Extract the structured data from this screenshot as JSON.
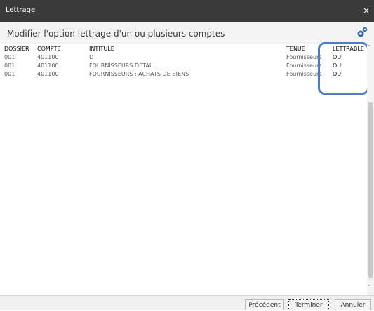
{
  "window": {
    "title": "Lettrage",
    "close_glyph": "×"
  },
  "header": {
    "title": "Modifier l'option lettrage d'un ou plusieurs comptes",
    "icon": "gear-icon"
  },
  "table": {
    "columns": [
      "DOSSIER",
      "COMPTE",
      "INTITULE",
      "TENUE",
      "LETTRABLE"
    ],
    "rows": [
      {
        "dossier": "001",
        "compte": "401100",
        "intitule": "D",
        "tenue": "Fournisseurs",
        "lettrable": "OUI"
      },
      {
        "dossier": "001",
        "compte": "401100",
        "intitule": "FOURNISSEURS DETAIL",
        "tenue": "Fournisseurs",
        "lettrable": "OUI"
      },
      {
        "dossier": "001",
        "compte": "401100",
        "intitule": "FOURNISSEURS : ACHATS DE BIENS",
        "tenue": "Fournisseurs",
        "lettrable": "OUI"
      }
    ]
  },
  "scrollbar": {
    "up": "˄",
    "down": "˅"
  },
  "footer": {
    "previous": "Précédent",
    "finish": "Terminer",
    "cancel": "Annuler"
  },
  "colors": {
    "titlebar": "#3a3a3a",
    "highlight": "#4a7fc6"
  }
}
